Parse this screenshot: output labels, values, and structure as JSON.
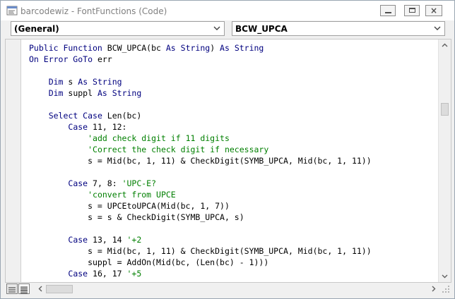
{
  "window": {
    "title": "barcodewiz - FontFunctions (Code)",
    "buttons": {
      "minimize": "minimize",
      "maximize": "maximize",
      "close": "×"
    }
  },
  "object_combo": {
    "value": "(General)"
  },
  "procedure_combo": {
    "value": "BCW_UPCA"
  },
  "code_lines": [
    [
      {
        "t": "Public Function ",
        "c": "kw"
      },
      {
        "t": "BCW_UPCA(bc "
      },
      {
        "t": "As String",
        "c": "kw"
      },
      {
        "t": ") "
      },
      {
        "t": "As String",
        "c": "kw"
      }
    ],
    [
      {
        "t": "On Error GoTo ",
        "c": "kw"
      },
      {
        "t": "err"
      }
    ],
    [],
    [
      {
        "t": "    "
      },
      {
        "t": "Dim ",
        "c": "kw"
      },
      {
        "t": "s "
      },
      {
        "t": "As String",
        "c": "kw"
      }
    ],
    [
      {
        "t": "    "
      },
      {
        "t": "Dim ",
        "c": "kw"
      },
      {
        "t": "suppl "
      },
      {
        "t": "As String",
        "c": "kw"
      }
    ],
    [],
    [
      {
        "t": "    "
      },
      {
        "t": "Select Case ",
        "c": "kw"
      },
      {
        "t": "Len(bc)"
      }
    ],
    [
      {
        "t": "        "
      },
      {
        "t": "Case ",
        "c": "kw"
      },
      {
        "t": "11, 12:"
      }
    ],
    [
      {
        "t": "            "
      },
      {
        "t": "'add check digit if 11 digits",
        "c": "cm"
      }
    ],
    [
      {
        "t": "            "
      },
      {
        "t": "'Correct the check digit if necessary",
        "c": "cm"
      }
    ],
    [
      {
        "t": "            s = Mid(bc, 1, 11) & CheckDigit(SYMB_UPCA, Mid(bc, 1, 11))"
      }
    ],
    [],
    [
      {
        "t": "        "
      },
      {
        "t": "Case ",
        "c": "kw"
      },
      {
        "t": "7, 8: "
      },
      {
        "t": "'UPC-E?",
        "c": "cm"
      }
    ],
    [
      {
        "t": "            "
      },
      {
        "t": "'convert from UPCE",
        "c": "cm"
      }
    ],
    [
      {
        "t": "            s = UPCEtoUPCA(Mid(bc, 1, 7))"
      }
    ],
    [
      {
        "t": "            s = s & CheckDigit(SYMB_UPCA, s)"
      }
    ],
    [],
    [
      {
        "t": "        "
      },
      {
        "t": "Case ",
        "c": "kw"
      },
      {
        "t": "13, 14 "
      },
      {
        "t": "'+2",
        "c": "cm"
      }
    ],
    [
      {
        "t": "            s = Mid(bc, 1, 11) & CheckDigit(SYMB_UPCA, Mid(bc, 1, 11))"
      }
    ],
    [
      {
        "t": "            suppl = AddOn(Mid(bc, (Len(bc) - 1)))"
      }
    ],
    [
      {
        "t": "        "
      },
      {
        "t": "Case ",
        "c": "kw"
      },
      {
        "t": "16, 17 "
      },
      {
        "t": "'+5",
        "c": "cm"
      }
    ]
  ],
  "scrollbars": {
    "vertical_position": 0.25,
    "vertical_visible_fraction": 0.06,
    "horizontal_position": 0.0,
    "horizontal_visible_fraction": 0.07
  },
  "colors": {
    "keyword": "#00007f",
    "comment": "#007f00",
    "text": "#000000"
  },
  "icons": {
    "app": "vba-project-icon",
    "object_arrow": "chevron-down-icon",
    "procedure_arrow": "chevron-down-icon",
    "procedure_view": "procedure-view-icon",
    "full_module_view": "full-module-view-icon"
  }
}
